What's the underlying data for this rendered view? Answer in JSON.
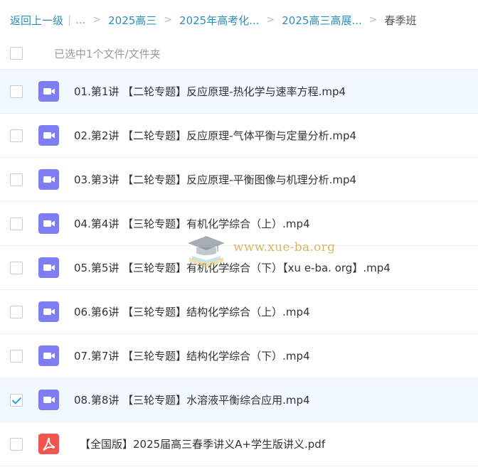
{
  "breadcrumb": {
    "back_label": "返回上一级",
    "divider": "|",
    "ellipsis": "...",
    "separator": ">",
    "items": [
      {
        "label": "2025高三"
      },
      {
        "label": "2025年高考化..."
      },
      {
        "label": "2025高三高展..."
      }
    ],
    "current": "春季班"
  },
  "selection": {
    "label": "已选中1个文件/文件夹"
  },
  "files": [
    {
      "name": "01.第1讲 【二轮专题】反应原理-热化学与速率方程.mp4",
      "type": "video",
      "selected": false,
      "highlighted": true
    },
    {
      "name": "02.第2讲 【二轮专题】反应原理-气体平衡与定量分析.mp4",
      "type": "video",
      "selected": false,
      "highlighted": false
    },
    {
      "name": "03.第3讲 【二轮专题】反应原理-平衡图像与机理分析.mp4",
      "type": "video",
      "selected": false,
      "highlighted": false
    },
    {
      "name": "04.第4讲 【三轮专题】有机化学综合（上）.mp4",
      "type": "video",
      "selected": false,
      "highlighted": false
    },
    {
      "name": "05.第5讲 【三轮专题】有机化学综合（下）【xu e-ba. org】.mp4",
      "type": "video",
      "selected": false,
      "highlighted": false
    },
    {
      "name": "06.第6讲 【三轮专题】结构化学综合（上）.mp4",
      "type": "video",
      "selected": false,
      "highlighted": false
    },
    {
      "name": "07.第7讲 【三轮专题】结构化学综合（下）.mp4",
      "type": "video",
      "selected": false,
      "highlighted": false
    },
    {
      "name": "08.第8讲 【三轮专题】水溶液平衡综合应用.mp4",
      "type": "video",
      "selected": true,
      "highlighted": true
    },
    {
      "name": "【全国版】2025届高三春季讲义A+学生版讲义.pdf",
      "type": "pdf",
      "selected": false,
      "highlighted": false
    }
  ],
  "icons": {
    "video": "video-file-icon",
    "pdf": "pdf-file-icon"
  },
  "colors": {
    "link": "#2a8fbd",
    "video_icon": "#7e7df2",
    "pdf_icon": "#f0564f",
    "check": "#2aa0e0",
    "row_highlight": "#f1f9fe"
  },
  "watermark": {
    "text": "www.xue-ba.org"
  }
}
